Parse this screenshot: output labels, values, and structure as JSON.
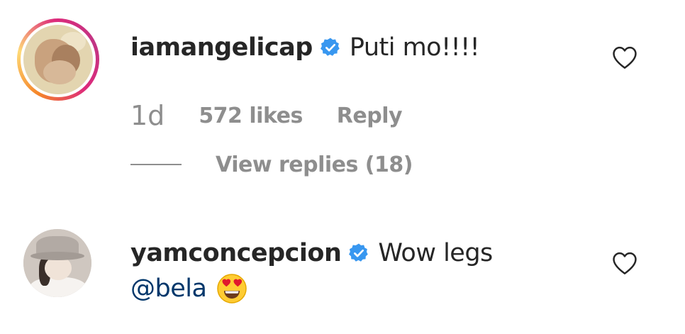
{
  "comments": [
    {
      "username": "iamangelicap",
      "verified": true,
      "text": "Puti mo!!!!",
      "time": "1d",
      "likes": "572 likes",
      "reply_label": "Reply",
      "view_replies": "View replies (18)",
      "avatar_story_ring": true,
      "like_icon": "heart-outline-icon"
    },
    {
      "username": "yamconcepcion",
      "verified": true,
      "text": "Wow legs",
      "mention": "@bela",
      "emoji": "heart-eyes-emoji",
      "like_icon": "heart-outline-icon"
    }
  ],
  "colors": {
    "text": "#262626",
    "meta": "#8e8e8e",
    "mention": "#00376b",
    "verified": "#3897f0"
  }
}
